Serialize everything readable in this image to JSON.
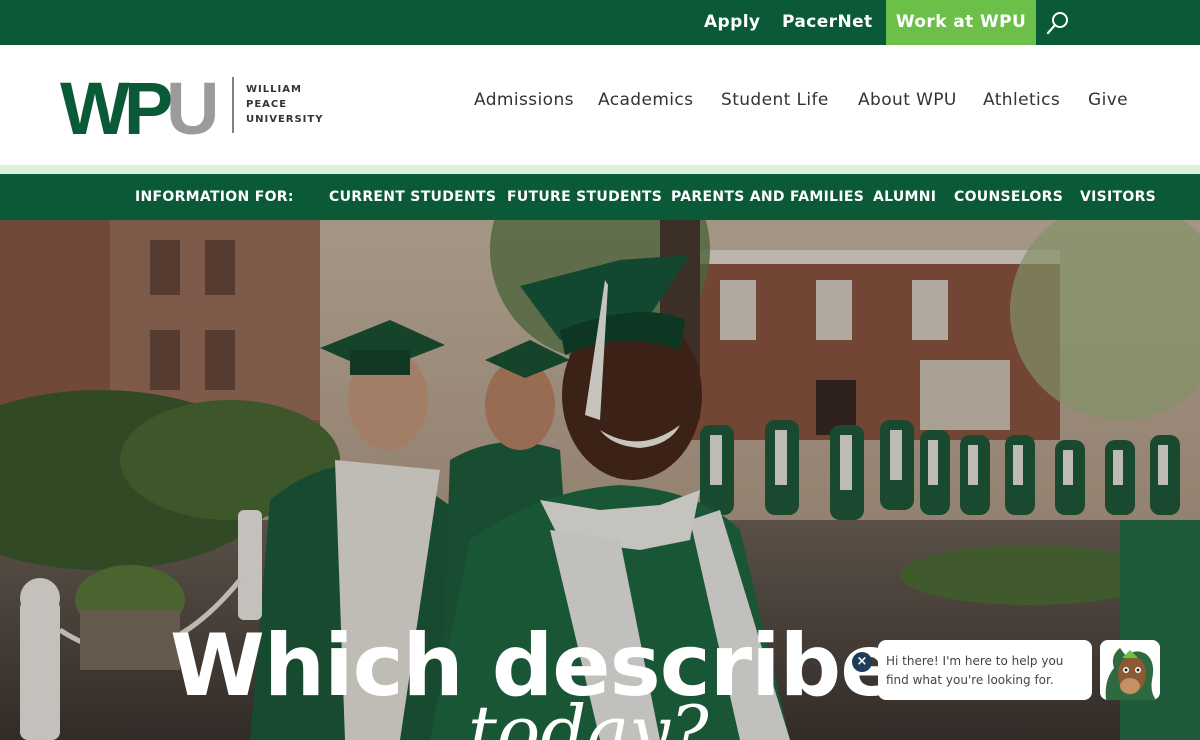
{
  "utility": {
    "apply": "Apply",
    "pacernet": "PacerNet",
    "work": "Work at WPU",
    "search_icon": "search-icon"
  },
  "logo": {
    "mark": "WPU",
    "line1": "WILLIAM",
    "line2": "PEACE",
    "line3": "UNIVERSITY"
  },
  "nav": {
    "admissions": "Admissions",
    "academics": "Academics",
    "student_life": "Student Life",
    "about": "About WPU",
    "athletics": "Athletics",
    "give": "Give"
  },
  "info": {
    "label": "INFORMATION FOR:",
    "current": "CURRENT STUDENTS",
    "future": "FUTURE STUDENTS",
    "parents": "PARENTS AND FAMILIES",
    "alumni": "ALUMNI",
    "counselors": "COUNSELORS",
    "visitors": "VISITORS"
  },
  "hero": {
    "title": "Which describes",
    "subtitle": "today?"
  },
  "chat": {
    "close": "×",
    "message": "Hi there! I'm here to help you find what you're looking for."
  },
  "colors": {
    "brand_green": "#0a5a38",
    "accent_green": "#6cc04a",
    "logo_gray": "#9b9b9b"
  }
}
